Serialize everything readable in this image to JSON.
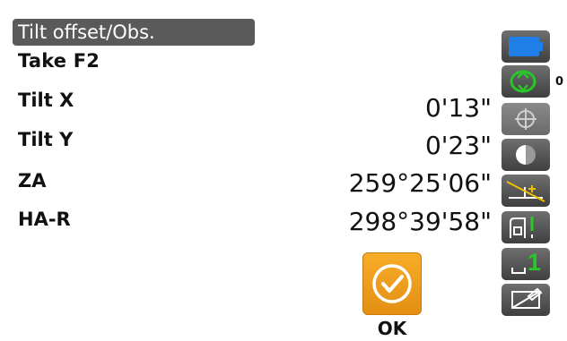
{
  "title": "Tilt offset/Obs.",
  "prompt": "Take F2",
  "rows": [
    {
      "label": "Tilt X",
      "value": "0'13\""
    },
    {
      "label": "Tilt Y",
      "value": "0'23\""
    },
    {
      "label": "ZA",
      "value": "259°25'06\""
    },
    {
      "label": "HA-R",
      "value": "298°39'58\""
    }
  ],
  "ok_button": {
    "label": "OK"
  },
  "status_panel": {
    "tilt_indicator_value": "0",
    "target_number": "1",
    "icons": [
      "battery-icon",
      "tilt-status-icon",
      "target-crosshair-icon",
      "target-type-icon",
      "ppm-correction-icon",
      "laser-plummet-icon",
      "target-number-icon",
      "input-mode-icon"
    ]
  },
  "colors": {
    "title_bg": "#5a5a5a",
    "ok_button": "#f0a020",
    "battery": "#1f7fe6",
    "status_green": "#28c828",
    "status_yellow": "#f0c000",
    "side_button_bg": "#555555"
  }
}
